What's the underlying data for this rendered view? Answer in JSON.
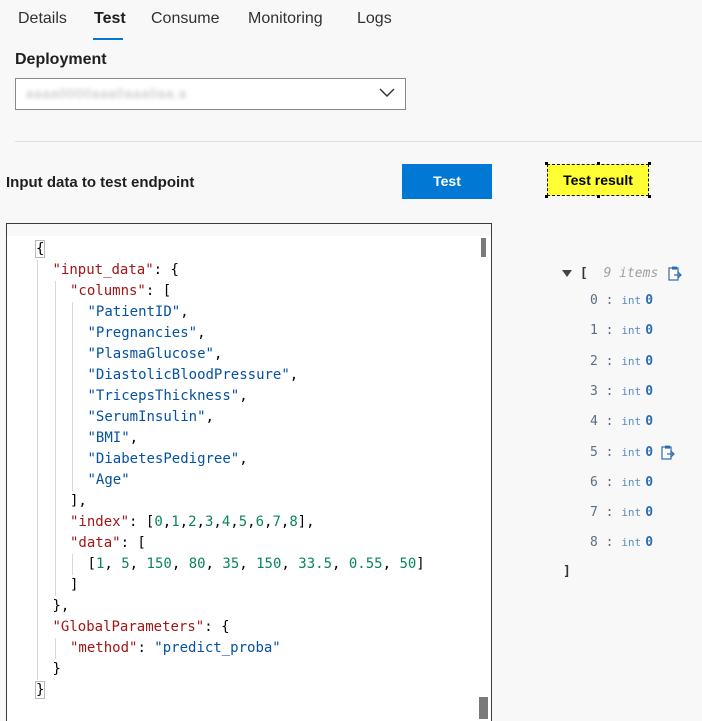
{
  "tabs": [
    {
      "label": "Details",
      "active": false
    },
    {
      "label": "Test",
      "active": true
    },
    {
      "label": "Consume",
      "active": false
    },
    {
      "label": "Monitoring",
      "active": false
    },
    {
      "label": "Logs",
      "active": false
    }
  ],
  "deployment": {
    "label": "Deployment",
    "value": "aaaa0000aaa0aaa0aa.a"
  },
  "test_panel": {
    "input_title": "Input data to test endpoint",
    "test_button": "Test",
    "result_label": "Test result"
  },
  "editor": {
    "lines": [
      {
        "indent": 0,
        "parts": [
          [
            "p",
            "{"
          ]
        ]
      },
      {
        "indent": 1,
        "parts": [
          [
            "k",
            "\"input_data\""
          ],
          [
            "p",
            ": {"
          ]
        ]
      },
      {
        "indent": 2,
        "parts": [
          [
            "k",
            "\"columns\""
          ],
          [
            "p",
            ": ["
          ]
        ]
      },
      {
        "indent": 3,
        "parts": [
          [
            "s",
            "\"PatientID\""
          ],
          [
            "p",
            ","
          ]
        ]
      },
      {
        "indent": 3,
        "parts": [
          [
            "s",
            "\"Pregnancies\""
          ],
          [
            "p",
            ","
          ]
        ]
      },
      {
        "indent": 3,
        "parts": [
          [
            "s",
            "\"PlasmaGlucose\""
          ],
          [
            "p",
            ","
          ]
        ]
      },
      {
        "indent": 3,
        "parts": [
          [
            "s",
            "\"DiastolicBloodPressure\""
          ],
          [
            "p",
            ","
          ]
        ]
      },
      {
        "indent": 3,
        "parts": [
          [
            "s",
            "\"TricepsThickness\""
          ],
          [
            "p",
            ","
          ]
        ]
      },
      {
        "indent": 3,
        "parts": [
          [
            "s",
            "\"SerumInsulin\""
          ],
          [
            "p",
            ","
          ]
        ]
      },
      {
        "indent": 3,
        "parts": [
          [
            "s",
            "\"BMI\""
          ],
          [
            "p",
            ","
          ]
        ]
      },
      {
        "indent": 3,
        "parts": [
          [
            "s",
            "\"DiabetesPedigree\""
          ],
          [
            "p",
            ","
          ]
        ]
      },
      {
        "indent": 3,
        "parts": [
          [
            "s",
            "\"Age\""
          ]
        ]
      },
      {
        "indent": 2,
        "parts": [
          [
            "p",
            "],"
          ]
        ]
      },
      {
        "indent": 2,
        "parts": [
          [
            "k",
            "\"index\""
          ],
          [
            "p",
            ": ["
          ],
          [
            "n",
            "0"
          ],
          [
            "p",
            ","
          ],
          [
            "n",
            "1"
          ],
          [
            "p",
            ","
          ],
          [
            "n",
            "2"
          ],
          [
            "p",
            ","
          ],
          [
            "n",
            "3"
          ],
          [
            "p",
            ","
          ],
          [
            "n",
            "4"
          ],
          [
            "p",
            ","
          ],
          [
            "n",
            "5"
          ],
          [
            "p",
            ","
          ],
          [
            "n",
            "6"
          ],
          [
            "p",
            ","
          ],
          [
            "n",
            "7"
          ],
          [
            "p",
            ","
          ],
          [
            "n",
            "8"
          ],
          [
            "p",
            "],"
          ]
        ]
      },
      {
        "indent": 2,
        "parts": [
          [
            "k",
            "\"data\""
          ],
          [
            "p",
            ": ["
          ]
        ]
      },
      {
        "indent": 3,
        "parts": [
          [
            "p",
            "["
          ],
          [
            "n",
            "1"
          ],
          [
            "p",
            ", "
          ],
          [
            "n",
            "5"
          ],
          [
            "p",
            ", "
          ],
          [
            "n",
            "150"
          ],
          [
            "p",
            ", "
          ],
          [
            "n",
            "80"
          ],
          [
            "p",
            ", "
          ],
          [
            "n",
            "35"
          ],
          [
            "p",
            ", "
          ],
          [
            "n",
            "150"
          ],
          [
            "p",
            ", "
          ],
          [
            "n",
            "33.5"
          ],
          [
            "p",
            ", "
          ],
          [
            "n",
            "0.55"
          ],
          [
            "p",
            ", "
          ],
          [
            "n",
            "50"
          ],
          [
            "p",
            "]"
          ]
        ]
      },
      {
        "indent": 2,
        "parts": [
          [
            "p",
            "]"
          ]
        ]
      },
      {
        "indent": 1,
        "parts": [
          [
            "p",
            "},"
          ]
        ]
      },
      {
        "indent": 1,
        "parts": [
          [
            "k",
            "\"GlobalParameters\""
          ],
          [
            "p",
            ": {"
          ]
        ]
      },
      {
        "indent": 2,
        "parts": [
          [
            "k",
            "\"method\""
          ],
          [
            "p",
            ": "
          ],
          [
            "s",
            "\"predict_proba\""
          ]
        ]
      },
      {
        "indent": 1,
        "parts": [
          [
            "p",
            "}"
          ]
        ]
      },
      {
        "indent": 0,
        "parts": [
          [
            "p",
            "}"
          ]
        ]
      }
    ]
  },
  "result": {
    "open_bracket": "[",
    "count_label": "9 items",
    "close_bracket": "]",
    "items": [
      {
        "index": "0",
        "type": "int",
        "value": "0"
      },
      {
        "index": "1",
        "type": "int",
        "value": "0"
      },
      {
        "index": "2",
        "type": "int",
        "value": "0"
      },
      {
        "index": "3",
        "type": "int",
        "value": "0"
      },
      {
        "index": "4",
        "type": "int",
        "value": "0"
      },
      {
        "index": "5",
        "type": "int",
        "value": "0"
      },
      {
        "index": "6",
        "type": "int",
        "value": "0"
      },
      {
        "index": "7",
        "type": "int",
        "value": "0"
      },
      {
        "index": "8",
        "type": "int",
        "value": "0"
      }
    ]
  },
  "colors": {
    "accent": "#0078d4",
    "highlight": "#ffff33",
    "json_key": "#a31515",
    "json_string": "#0451a5",
    "json_number": "#098658"
  },
  "icons": {
    "dropdown": "chevron-down-icon",
    "copy": "copy-icon",
    "collapse": "caret-down-icon"
  }
}
